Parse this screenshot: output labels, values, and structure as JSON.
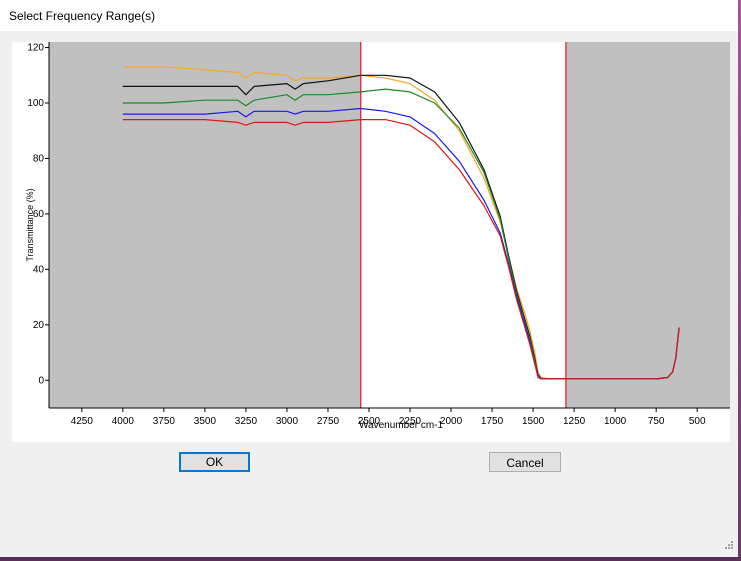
{
  "window": {
    "title": "Select Frequency Range(s)"
  },
  "buttons": {
    "ok_label": "OK",
    "cancel_label": "Cancel"
  },
  "selection": {
    "range_start": 2550,
    "range_end": 1300,
    "marker_color": "#e8151b",
    "shade_color": "#c0c0c0"
  },
  "chart_data": {
    "type": "line",
    "xlabel": "Wavenumber cm-1",
    "ylabel": "Transmittance (%)",
    "xlim": [
      4450,
      300
    ],
    "ylim": [
      -10,
      122
    ],
    "x_reversed": true,
    "grid": false,
    "xticks": [
      4250,
      4000,
      3750,
      3500,
      3250,
      3000,
      2750,
      2500,
      2250,
      2000,
      1750,
      1500,
      1250,
      1000,
      750,
      500
    ],
    "yticks": [
      0,
      20,
      40,
      60,
      80,
      100,
      120
    ],
    "series": [
      {
        "color": "#f5a623",
        "x": [
          4000,
          3750,
          3500,
          3300,
          3250,
          3200,
          3000,
          2950,
          2900,
          2750,
          2550,
          2400,
          2250,
          2100,
          1950,
          1800,
          1700,
          1650,
          1600,
          1550,
          1520,
          1490,
          1470,
          1450,
          1400,
          1300,
          1000,
          750,
          680,
          650,
          630,
          610
        ],
        "y": [
          113,
          113,
          112,
          111,
          109,
          111,
          110,
          108,
          109,
          109,
          110,
          109,
          107,
          101,
          90,
          73,
          57,
          45,
          33,
          24,
          18,
          10,
          3,
          1,
          0.5,
          0.5,
          0.5,
          0.5,
          1,
          3,
          8,
          19
        ]
      },
      {
        "color": "#111111",
        "x": [
          4000,
          3750,
          3500,
          3300,
          3250,
          3200,
          3000,
          2950,
          2900,
          2750,
          2550,
          2400,
          2250,
          2100,
          1950,
          1800,
          1700,
          1650,
          1600,
          1550,
          1520,
          1490,
          1470,
          1450,
          1400,
          1300,
          1000,
          750,
          680,
          650,
          630,
          610
        ],
        "y": [
          106,
          106,
          106,
          106,
          103,
          106,
          107,
          105,
          107,
          108,
          110,
          110,
          109,
          104,
          93,
          76,
          59,
          45,
          32,
          22,
          16,
          8,
          2,
          0.5,
          0.5,
          0.5,
          0.5,
          0.5,
          1,
          3,
          8,
          19
        ]
      },
      {
        "color": "#1b8a2a",
        "x": [
          4000,
          3750,
          3500,
          3300,
          3250,
          3200,
          3000,
          2950,
          2900,
          2750,
          2550,
          2400,
          2250,
          2100,
          1950,
          1800,
          1700,
          1650,
          1600,
          1550,
          1520,
          1490,
          1470,
          1450,
          1400,
          1300,
          1000,
          750,
          680,
          650,
          630,
          610
        ],
        "y": [
          100,
          100,
          101,
          101,
          99,
          101,
          103,
          101,
          103,
          103,
          104,
          105,
          104,
          100,
          91,
          75,
          58,
          44,
          31,
          21,
          15,
          7,
          2,
          0.5,
          0.5,
          0.5,
          0.5,
          0.5,
          1,
          3,
          8,
          19
        ]
      },
      {
        "color": "#1a1aee",
        "x": [
          4000,
          3750,
          3500,
          3300,
          3250,
          3200,
          3000,
          2950,
          2900,
          2750,
          2550,
          2400,
          2250,
          2100,
          1950,
          1800,
          1700,
          1650,
          1600,
          1550,
          1520,
          1490,
          1470,
          1450,
          1400,
          1300,
          1000,
          750,
          680,
          650,
          630,
          610
        ],
        "y": [
          96,
          96,
          96,
          97,
          95,
          97,
          97,
          96,
          97,
          97,
          98,
          97,
          95,
          89,
          79,
          65,
          53,
          42,
          30,
          20,
          14,
          6,
          2,
          0.5,
          0.5,
          0.5,
          0.5,
          0.5,
          1,
          3,
          8,
          19
        ]
      },
      {
        "color": "#e21515",
        "x": [
          4000,
          3750,
          3500,
          3300,
          3250,
          3200,
          3000,
          2950,
          2900,
          2750,
          2550,
          2400,
          2250,
          2100,
          1950,
          1800,
          1700,
          1650,
          1600,
          1550,
          1520,
          1490,
          1470,
          1450,
          1400,
          1300,
          1000,
          750,
          680,
          650,
          630,
          610
        ],
        "y": [
          94,
          94,
          94,
          93,
          92,
          93,
          93,
          92,
          93,
          93,
          94,
          94,
          92,
          86,
          76,
          63,
          52,
          41,
          29,
          19,
          13,
          6,
          1,
          0.5,
          0.5,
          0.5,
          0.5,
          0.5,
          1,
          3,
          8,
          19
        ]
      }
    ]
  }
}
